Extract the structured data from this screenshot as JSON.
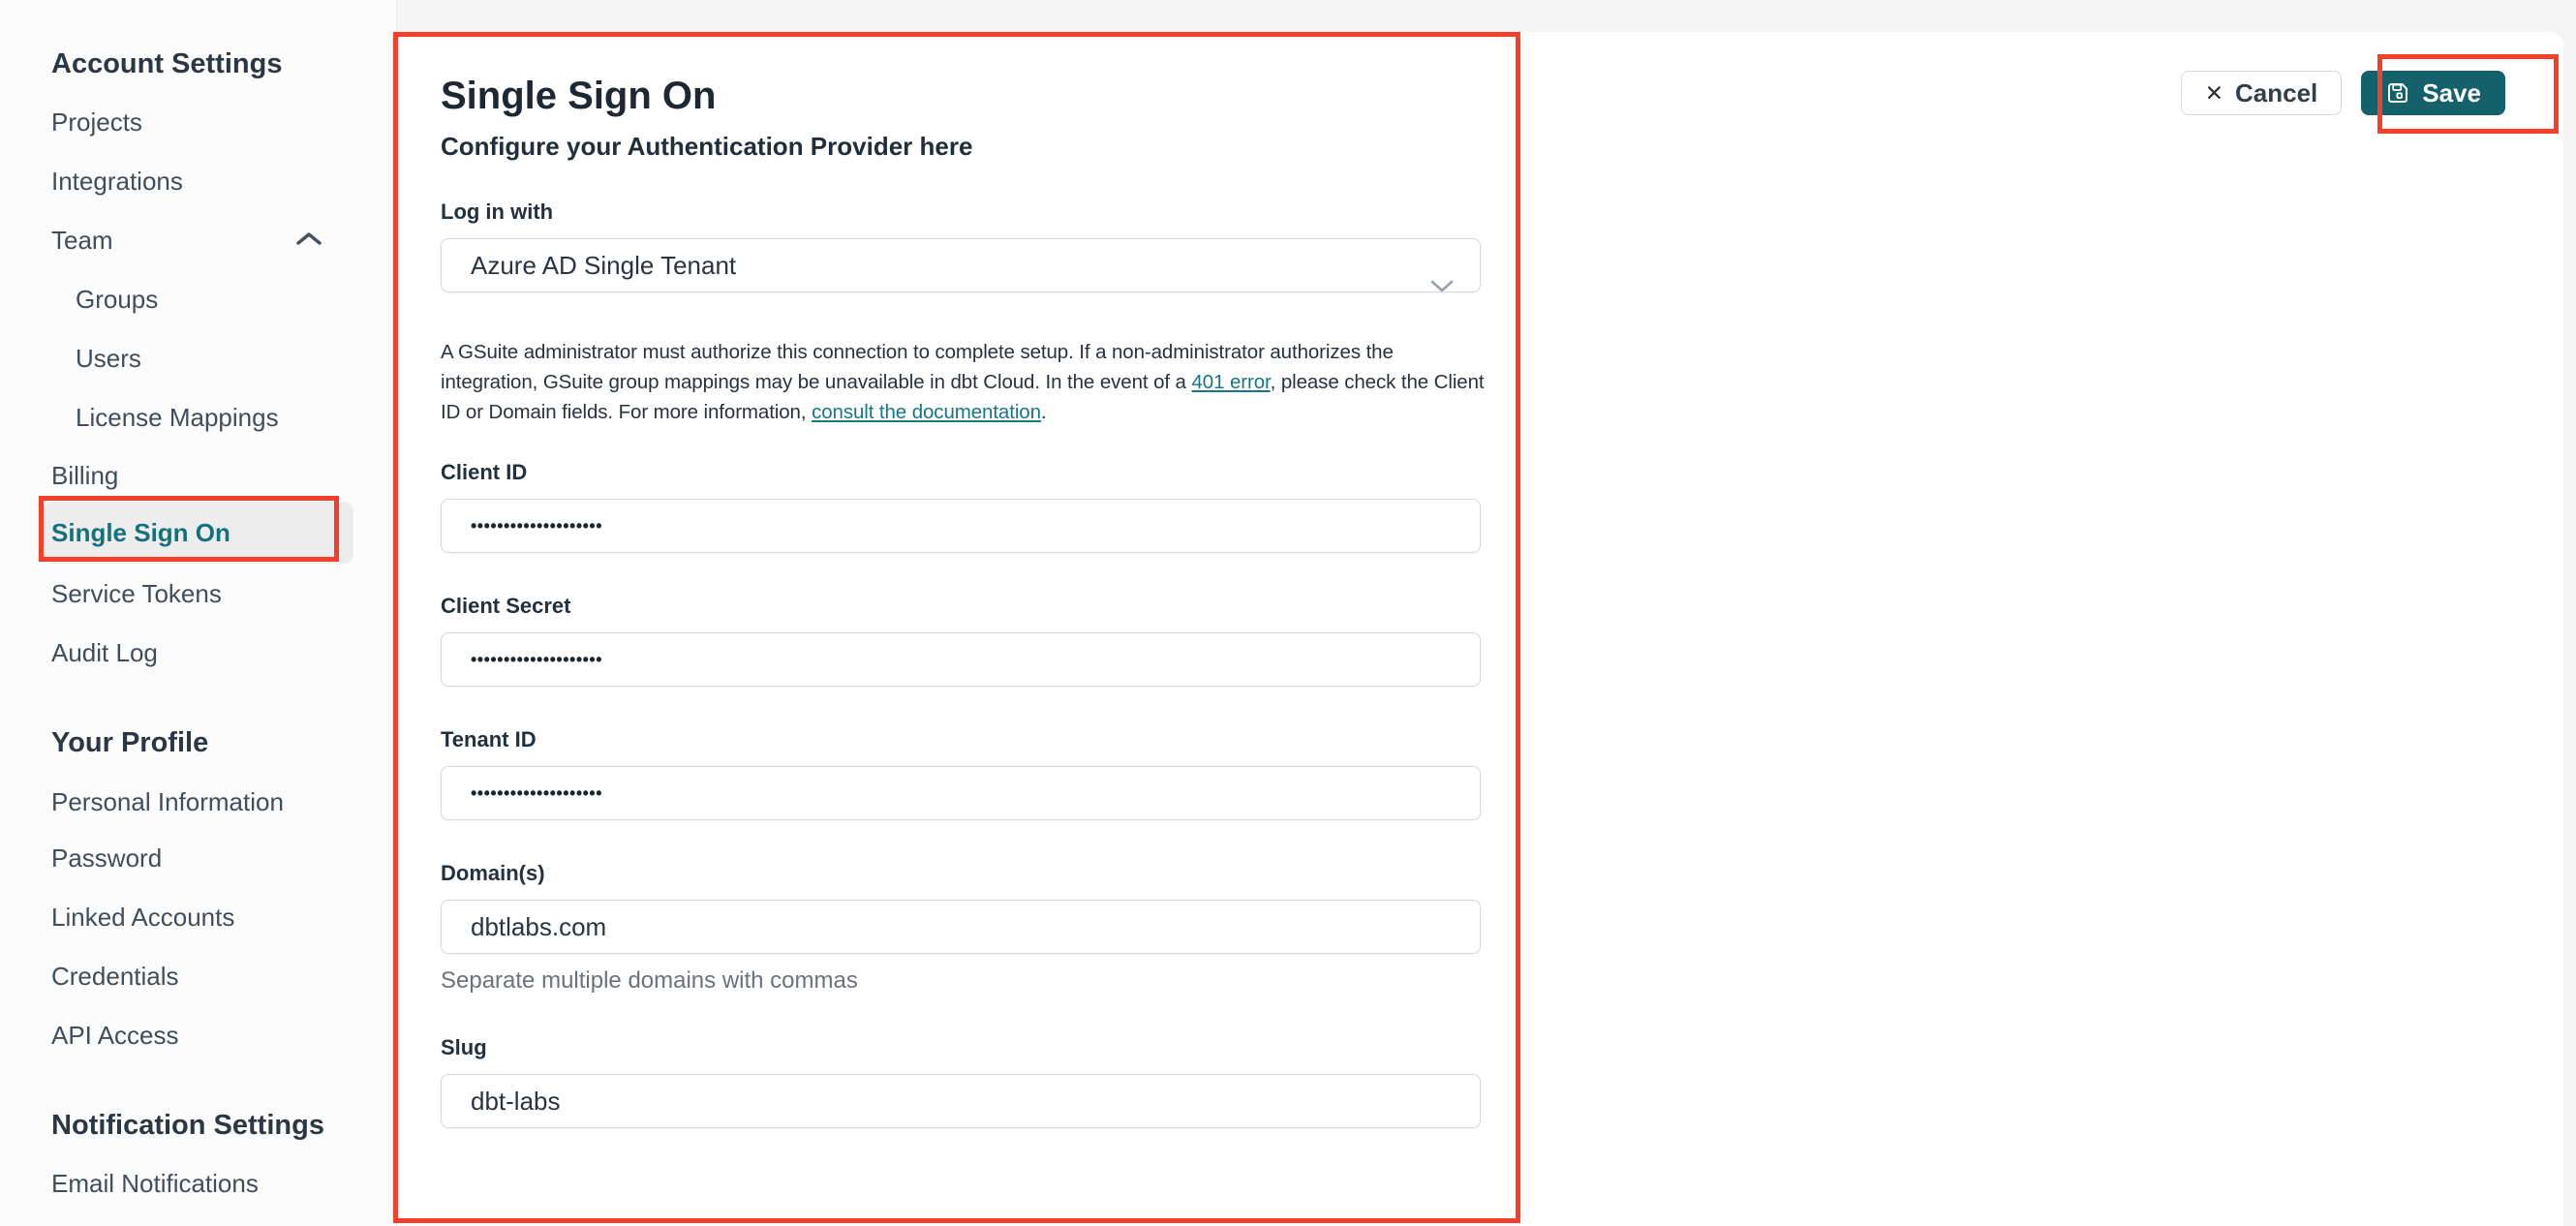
{
  "app": {
    "accent_teal": "#15717d",
    "save_teal": "#14606b",
    "annotation_red": "#f4402b",
    "page_bg": "#f5f5f6"
  },
  "sidebar": {
    "sections": [
      {
        "heading": "Account Settings",
        "items": [
          {
            "label": "Projects"
          },
          {
            "label": "Integrations"
          },
          {
            "label": "Team",
            "icon": "chevron-up-icon",
            "expanded": true
          },
          {
            "label": "Groups",
            "indent": true
          },
          {
            "label": "Users",
            "indent": true
          },
          {
            "label": "License Mappings",
            "indent": true
          },
          {
            "label": "Billing"
          },
          {
            "label": "Single Sign On",
            "active": true
          },
          {
            "label": "Service Tokens"
          },
          {
            "label": "Audit Log"
          }
        ]
      },
      {
        "heading": "Your Profile",
        "items": [
          {
            "label": "Personal Information"
          },
          {
            "label": "Password"
          },
          {
            "label": "Linked Accounts"
          },
          {
            "label": "Credentials"
          },
          {
            "label": "API Access"
          }
        ]
      },
      {
        "heading": "Notification Settings",
        "items": [
          {
            "label": "Email Notifications"
          }
        ]
      }
    ]
  },
  "main": {
    "title": "Single Sign On",
    "subtitle": "Configure your Authentication Provider here",
    "actions": {
      "cancel_label": "Cancel",
      "cancel_icon": "x-icon",
      "save_label": "Save",
      "save_icon": "floppy-disk-icon"
    },
    "form": {
      "login_with": {
        "label": "Log in with",
        "value": "Azure AD Single Tenant",
        "icon": "chevron-down-icon"
      },
      "notice": {
        "line1": "A GSuite administrator must authorize this connection to complete setup. If a non-administrator authorizes the",
        "line2a": "integration, GSuite group mappings may be unavailable in dbt Cloud. In the event of a ",
        "link1": "401 error",
        "line2b": ", please check the Client",
        "line3a": "ID or Domain fields. For more information, ",
        "link2": "consult the documentation",
        "line3b": "."
      },
      "client_id": {
        "label": "Client ID",
        "value": "••••••••••••••••••••",
        "masked": true
      },
      "client_secret": {
        "label": "Client Secret",
        "value": "••••••••••••••••••••",
        "masked": true
      },
      "tenant_id": {
        "label": "Tenant ID",
        "value": "••••••••••••••••••••",
        "masked": true
      },
      "domains": {
        "label": "Domain(s)",
        "value": "dbtlabs.com",
        "helper": "Separate multiple domains with commas"
      },
      "slug": {
        "label": "Slug",
        "value": "dbt-labs"
      }
    }
  }
}
